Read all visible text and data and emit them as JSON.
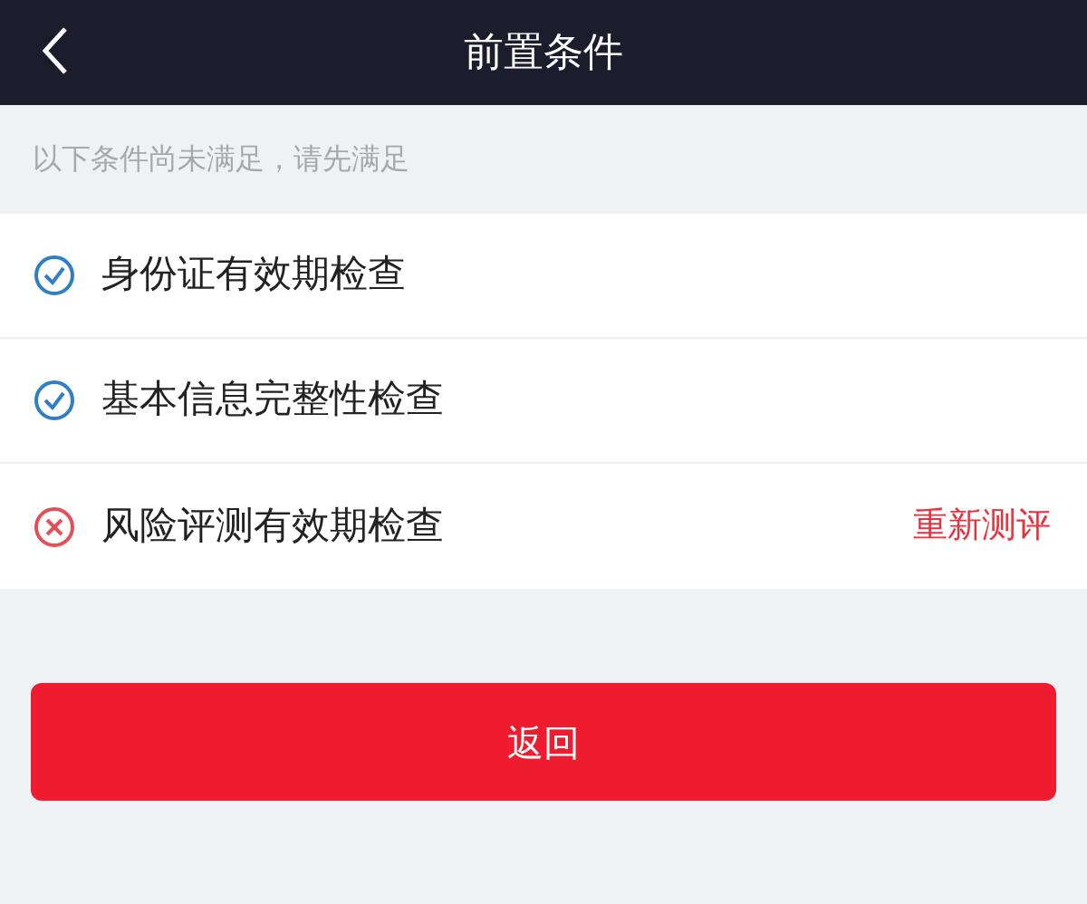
{
  "header": {
    "title": "前置条件"
  },
  "notice": "以下条件尚未满足，请先满足",
  "checks": [
    {
      "label": "身份证有效期检查",
      "passed": true
    },
    {
      "label": "基本信息完整性检查",
      "passed": true
    },
    {
      "label": "风险评测有效期检查",
      "passed": false,
      "action": "重新测评"
    }
  ],
  "button": "返回"
}
